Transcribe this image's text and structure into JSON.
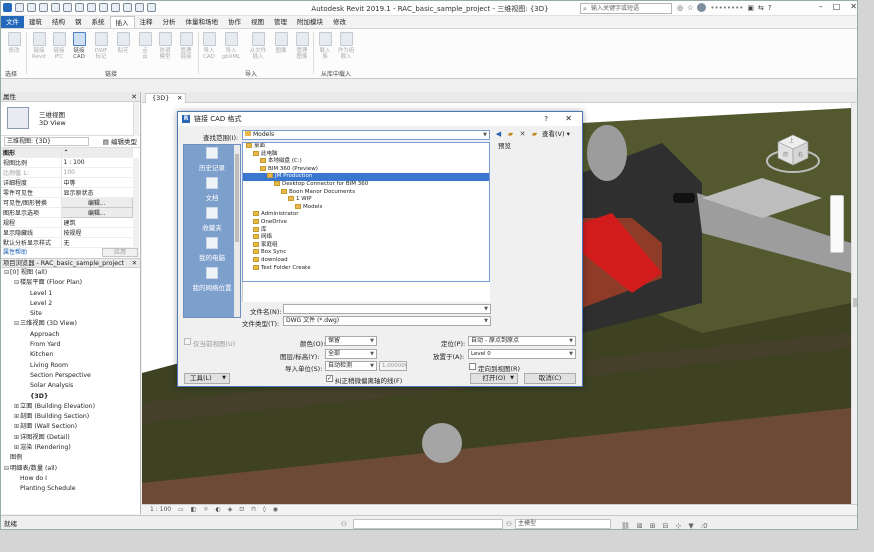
{
  "app": {
    "title": "Autodesk Revit 2019.1 - RAC_basic_sample_project - 三维视图: {3D}",
    "search_placeholder": "输入关键字或短语",
    "user": "••••••••"
  },
  "ribbon": {
    "tabs": [
      "文件",
      "建筑",
      "结构",
      "钢",
      "系统",
      "插入",
      "注释",
      "分析",
      "体量和场地",
      "协作",
      "视图",
      "管理",
      "附加模块",
      "修改"
    ],
    "active_tab": "插入",
    "buttons": [
      {
        "label": "修改",
        "sub": ""
      },
      {
        "label": "链接",
        "sub": "Revit"
      },
      {
        "label": "链接",
        "sub": "IFC"
      },
      {
        "label": "链接",
        "sub": "CAD"
      },
      {
        "label": "DWF",
        "sub": "标记"
      },
      {
        "label": "贴花",
        "sub": ""
      },
      {
        "label": "点",
        "sub": "云"
      },
      {
        "label": "协调",
        "sub": "模型"
      },
      {
        "label": "管理",
        "sub": "链接"
      },
      {
        "label": "导入",
        "sub": "CAD"
      },
      {
        "label": "导入",
        "sub": "gbXML"
      },
      {
        "label": "从文件",
        "sub": "插入"
      },
      {
        "label": "图像",
        "sub": ""
      },
      {
        "label": "管理",
        "sub": "图像"
      },
      {
        "label": "载入",
        "sub": "族"
      },
      {
        "label": "作为组",
        "sub": "载入"
      }
    ],
    "groups": [
      "选择",
      "链接",
      "导入",
      "从库中载入"
    ]
  },
  "properties": {
    "header": "属性",
    "type_name": "三维视图",
    "type_sub": "3D View",
    "view_selector": "三维视图: {3D}",
    "edit_type": "编辑类型",
    "rows": [
      {
        "name": "图形",
        "value": "",
        "section": true
      },
      {
        "name": "视图比例",
        "value": "1 : 100"
      },
      {
        "name": "比例值 1:",
        "value": "100"
      },
      {
        "name": "详细程度",
        "value": "中等"
      },
      {
        "name": "零件可见性",
        "value": "显示原状态"
      },
      {
        "name": "可见性/图形替换",
        "value": "编辑...",
        "button": true
      },
      {
        "name": "图形显示选项",
        "value": "编辑...",
        "button": true
      },
      {
        "name": "规程",
        "value": "建筑"
      },
      {
        "name": "显示隐藏线",
        "value": "按规程"
      },
      {
        "name": "默认分析显示样式",
        "value": "无"
      }
    ],
    "help_link": "属性帮助",
    "apply": "应用"
  },
  "browser": {
    "header": "项目浏览器 - RAC_basic_sample_project",
    "items": [
      {
        "indent": 0,
        "toggle": "⊟",
        "label": "[0] 视图 (all)"
      },
      {
        "indent": 1,
        "toggle": "⊟",
        "label": "楼层平面 (Floor Plan)"
      },
      {
        "indent": 2,
        "toggle": "",
        "label": "Level 1"
      },
      {
        "indent": 2,
        "toggle": "",
        "label": "Level 2"
      },
      {
        "indent": 2,
        "toggle": "",
        "label": "Site"
      },
      {
        "indent": 1,
        "toggle": "⊟",
        "label": "三维视图 (3D View)"
      },
      {
        "indent": 2,
        "toggle": "",
        "label": "Approach"
      },
      {
        "indent": 2,
        "toggle": "",
        "label": "From Yard"
      },
      {
        "indent": 2,
        "toggle": "",
        "label": "Kitchen"
      },
      {
        "indent": 2,
        "toggle": "",
        "label": "Living Room"
      },
      {
        "indent": 2,
        "toggle": "",
        "label": "Section Perspective"
      },
      {
        "indent": 2,
        "toggle": "",
        "label": "Solar Analysis"
      },
      {
        "indent": 2,
        "toggle": "",
        "label": "{3D}",
        "bold": true
      },
      {
        "indent": 1,
        "toggle": "⊞",
        "label": "立面 (Building Elevation)"
      },
      {
        "indent": 1,
        "toggle": "⊞",
        "label": "剖面 (Building Section)"
      },
      {
        "indent": 1,
        "toggle": "⊞",
        "label": "剖面 (Wall Section)"
      },
      {
        "indent": 1,
        "toggle": "⊞",
        "label": "详图视图 (Detail)"
      },
      {
        "indent": 1,
        "toggle": "⊞",
        "label": "渲染 (Rendering)"
      },
      {
        "indent": 0,
        "toggle": "",
        "label": "图例"
      },
      {
        "indent": 0,
        "toggle": "⊟",
        "label": "明细表/数量 (all)"
      },
      {
        "indent": 1,
        "toggle": "",
        "label": "How do I"
      },
      {
        "indent": 1,
        "toggle": "",
        "label": "Planting Schedule"
      }
    ]
  },
  "view": {
    "tab": "{3D}",
    "scale": "1 : 100",
    "viewcube_faces": [
      "上",
      "前",
      "右"
    ]
  },
  "status": {
    "text": "就绪",
    "model_combo": "主模型",
    "zero": ":0"
  },
  "dialog": {
    "title": "链接 CAD 格式",
    "help": "?",
    "lookin_label": "查找范围(I):",
    "lookin_value": "Models",
    "view_menu": "查看(V)",
    "preview_label": "预览",
    "places": [
      "历史记录",
      "文档",
      "收藏夹",
      "我的电脑",
      "我的网络位置"
    ],
    "tree": [
      {
        "indent": 0,
        "label": "桌面",
        "sel": false
      },
      {
        "indent": 1,
        "label": "此电脑",
        "sel": false
      },
      {
        "indent": 2,
        "label": "本地磁盘 (C:)",
        "sel": false
      },
      {
        "indent": 2,
        "label": "BIM 360 (Preview)",
        "sel": false
      },
      {
        "indent": 3,
        "label": "JM Production",
        "sel": true
      },
      {
        "indent": 4,
        "label": "Desktop Connector for BIM 360",
        "sel": false
      },
      {
        "indent": 5,
        "label": "Boon Manor Documents",
        "sel": false
      },
      {
        "indent": 6,
        "label": "1 WIP",
        "sel": false
      },
      {
        "indent": 7,
        "label": "Models",
        "sel": false
      },
      {
        "indent": 1,
        "label": "Administrator",
        "sel": false
      },
      {
        "indent": 1,
        "label": "OneDrive",
        "sel": false
      },
      {
        "indent": 1,
        "label": "库",
        "sel": false
      },
      {
        "indent": 1,
        "label": "网络",
        "sel": false
      },
      {
        "indent": 1,
        "label": "家庭组",
        "sel": false
      },
      {
        "indent": 1,
        "label": "Box Sync",
        "sel": false
      },
      {
        "indent": 1,
        "label": "download",
        "sel": false
      },
      {
        "indent": 1,
        "label": "Test Folder Create",
        "sel": false
      }
    ],
    "filename_label": "文件名(N):",
    "filename_value": "",
    "filetype_label": "文件类型(T):",
    "filetype_value": "DWG 文件 (*.dwg)",
    "current_view_only": "仅当前视图(U)",
    "colors_label": "颜色(O):",
    "colors_value": "保留",
    "layers_label": "图层/标高(Y):",
    "layers_value": "全部",
    "units_label": "导入单位(S):",
    "units_value": "自动检测",
    "units_factor": "1.000000",
    "correct_lines": "纠正稍微偏离轴的线(F)",
    "positioning_label": "定位(P):",
    "positioning_value": "自动 - 原点到原点",
    "place_at_label": "放置于(A):",
    "place_at_value": "Level 0",
    "orient_to_view": "定向到视图(R)",
    "tools": "工具(L)",
    "open": "打开(O)",
    "cancel": "取消(C)"
  }
}
